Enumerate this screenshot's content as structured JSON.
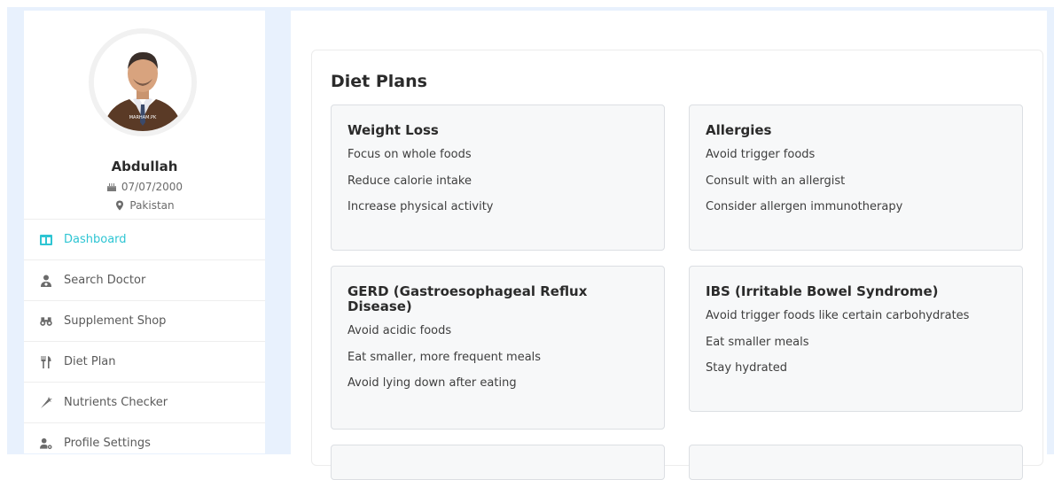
{
  "profile": {
    "name": "Abdullah",
    "dob": "07/07/2000",
    "country": "Pakistan",
    "avatar_watermark": "MARHAM.PK"
  },
  "sidebar": {
    "items": [
      {
        "label": "Dashboard",
        "icon": "dashboard-icon",
        "active": true
      },
      {
        "label": "Search Doctor",
        "icon": "doctor-icon"
      },
      {
        "label": "Supplement Shop",
        "icon": "binoculars-icon"
      },
      {
        "label": "Diet Plan",
        "icon": "utensils-icon"
      },
      {
        "label": "Nutrients Checker",
        "icon": "carrot-icon"
      },
      {
        "label": "Profile Settings",
        "icon": "user-gear-icon"
      }
    ]
  },
  "main": {
    "title": "Diet Plans",
    "cards": [
      {
        "title": "Weight Loss",
        "items": [
          "Focus on whole foods",
          "Reduce calorie intake",
          "Increase physical activity"
        ]
      },
      {
        "title": "Allergies",
        "items": [
          "Avoid trigger foods",
          "Consult with an allergist",
          "Consider allergen immunotherapy"
        ]
      },
      {
        "title": "GERD (Gastroesophageal Reflux Disease)",
        "items": [
          "Avoid acidic foods",
          "Eat smaller, more frequent meals",
          "Avoid lying down after eating"
        ]
      },
      {
        "title": "IBS (Irritable Bowel Syndrome)",
        "items": [
          "Avoid trigger foods like certain carbohydrates",
          "Eat smaller meals",
          "Stay hydrated"
        ]
      }
    ]
  },
  "colors": {
    "accent": "#2ec5d3",
    "background": "#e8f1fd",
    "card_bg": "#f7f8f9"
  }
}
